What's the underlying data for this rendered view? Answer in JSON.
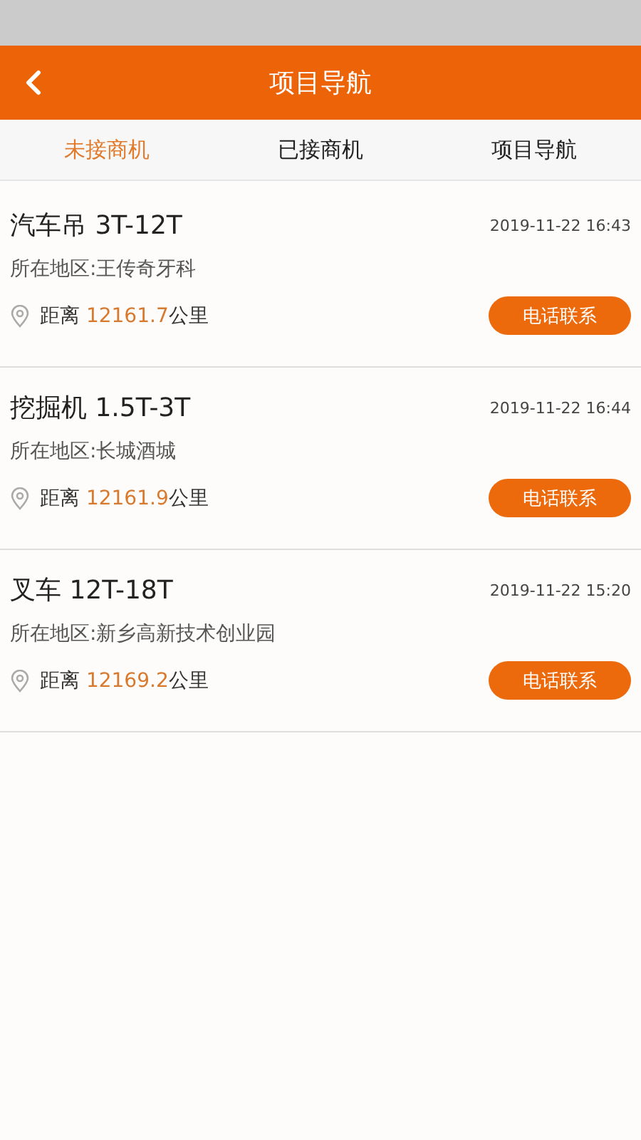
{
  "header": {
    "title": "项目导航"
  },
  "tabs": [
    {
      "label": "未接商机",
      "selected": true
    },
    {
      "label": "已接商机",
      "selected": false
    },
    {
      "label": "项目导航",
      "selected": false
    }
  ],
  "items": [
    {
      "title": "汽车吊 3T-12T",
      "time": "2019-11-22 16:43",
      "region": "所在地区:王传奇牙科",
      "distance_label": "距离",
      "distance": "12161.7",
      "unit": "公里",
      "button": "电话联系"
    },
    {
      "title": "挖掘机 1.5T-3T",
      "time": "2019-11-22 16:44",
      "region": "所在地区:长城酒城",
      "distance_label": "距离",
      "distance": "12161.9",
      "unit": "公里",
      "button": "电话联系"
    },
    {
      "title": "叉车 12T-18T",
      "time": "2019-11-22 15:20",
      "region": "所在地区:新乡高新技术创业园",
      "distance_label": "距离",
      "distance": "12169.2",
      "unit": "公里",
      "button": "电话联系"
    }
  ]
}
